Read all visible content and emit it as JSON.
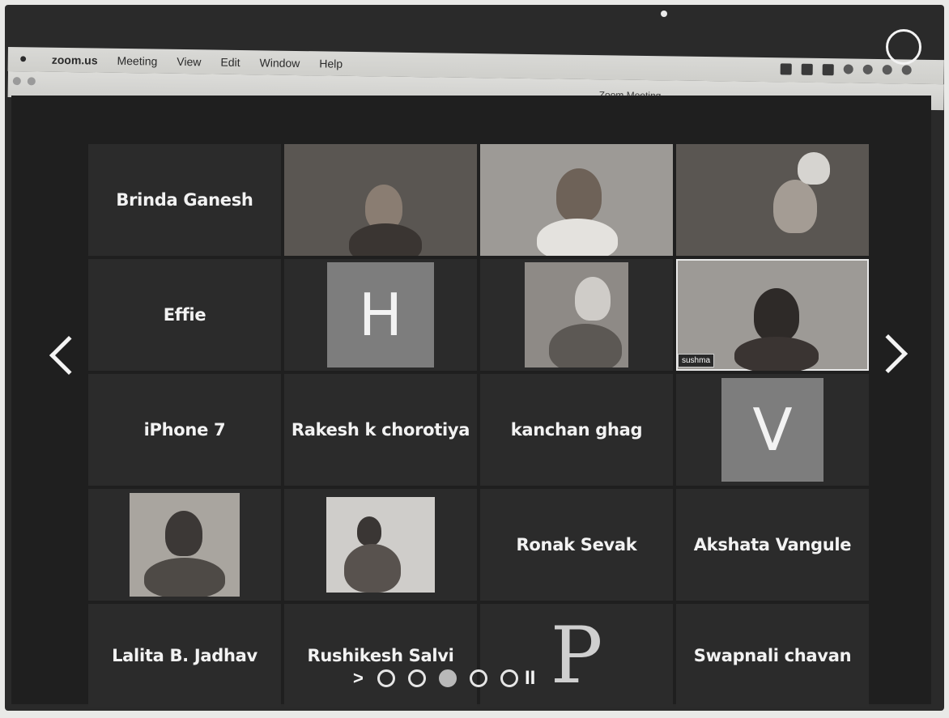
{
  "menubar": {
    "app": "zoom.us",
    "items": [
      "Meeting",
      "View",
      "Edit",
      "Window",
      "Help"
    ]
  },
  "window": {
    "title": "Zoom Meeting"
  },
  "participants": {
    "row1": {
      "name_tile": "Brinda Ganesh"
    },
    "row2": {
      "name_tile": "Effie",
      "avatar_letter": "H",
      "video_label": "sushma"
    },
    "row3": {
      "names": [
        "iPhone 7",
        "Rakesh k chorotiya",
        "kanchan ghag"
      ],
      "avatar_letter": "V"
    },
    "row4": {
      "names": [
        "Ronak Sevak",
        "Akshata Vangule"
      ]
    },
    "row5": {
      "names": [
        "Lalita B. Jadhav",
        "Rushikesh Salvi",
        "Swapnali chavan"
      ],
      "avatar_letter": "P"
    }
  },
  "pager": {
    "play_glyph": ">",
    "pause_glyph": "II",
    "pages": 5,
    "current": 3
  },
  "colors": {
    "background": "#1f1f1f",
    "tile": "#2b2b2b",
    "avatar": "#7d7d7d",
    "text": "#f2f2f2"
  },
  "icons": [
    "apple-icon",
    "prev-page-arrow-icon",
    "next-page-arrow-icon",
    "play-icon",
    "pause-icon"
  ]
}
